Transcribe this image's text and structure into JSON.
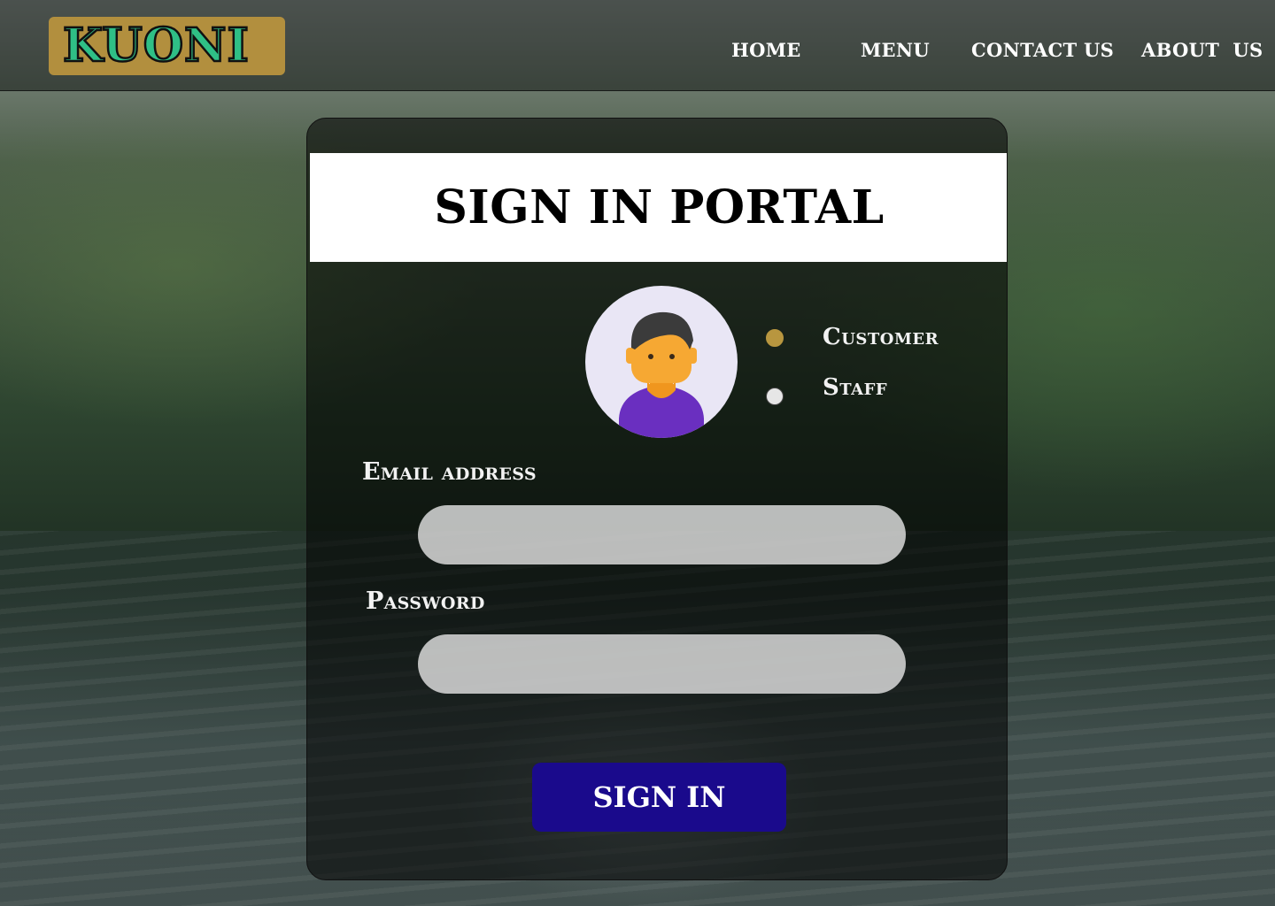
{
  "brand": {
    "logo_text": "KUONI"
  },
  "nav": {
    "items": [
      {
        "label": "HOME"
      },
      {
        "label": "MENU"
      },
      {
        "label": "CONTACT US"
      },
      {
        "label": "ABOUT  US"
      }
    ]
  },
  "portal": {
    "title": "SIGN IN PORTAL",
    "roles": [
      {
        "label": "Customer",
        "selected": true
      },
      {
        "label": "Staff",
        "selected": false
      }
    ],
    "email": {
      "label": "Email address",
      "value": "",
      "placeholder": ""
    },
    "password": {
      "label": "Password",
      "value": "",
      "placeholder": ""
    },
    "submit_label": "SIGN IN"
  },
  "colors": {
    "logo_bg": "#b28f3e",
    "logo_text": "#2fbf86",
    "radio_selected": "#b8963f",
    "button_bg": "#1a0a8c"
  }
}
